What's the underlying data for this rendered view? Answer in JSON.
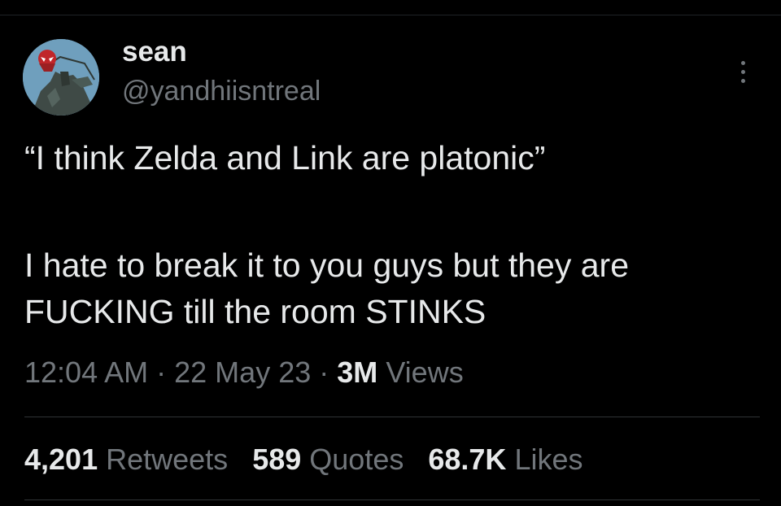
{
  "user": {
    "display_name": "sean",
    "handle": "@yandhiisntreal",
    "avatar_icon": "spider-man-avatar-icon"
  },
  "more_icon": "more-dots-vertical-icon",
  "tweet": {
    "line1": "“I think Zelda and Link are platonic”",
    "line2": "I hate to break it to you guys but they are",
    "line3": "FUCKING till the room STINKS"
  },
  "meta": {
    "time": "12:04 AM",
    "separator": "·",
    "date": "22 May 23",
    "views_count": "3M",
    "views_label": "Views"
  },
  "stats": {
    "retweets_count": "4,201",
    "retweets_label": "Retweets",
    "quotes_count": "589",
    "quotes_label": "Quotes",
    "likes_count": "68.7K",
    "likes_label": "Likes"
  },
  "colors": {
    "background": "#000000",
    "primary_text": "#e7e9ea",
    "secondary_text": "#71767b",
    "divider": "#2f3336"
  }
}
